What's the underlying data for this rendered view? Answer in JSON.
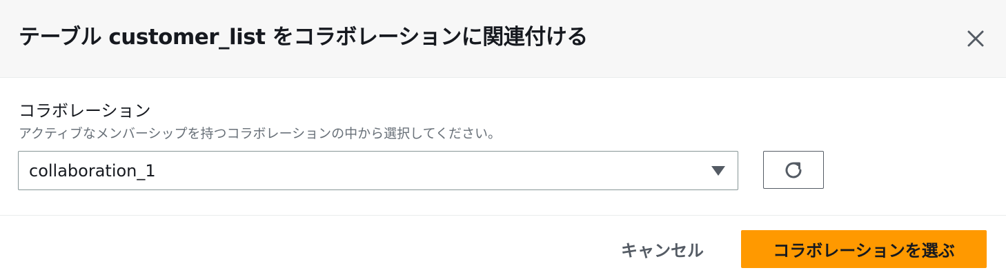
{
  "modal": {
    "title": "テーブル customer_list をコラボレーションに関連付ける",
    "close_icon": "close-icon"
  },
  "field": {
    "label": "コラボレーション",
    "description": "アクティブなメンバーシップを持つコラボレーションの中から選択してください。",
    "selected_value": "collaboration_1",
    "caret_icon": "caret-down-icon",
    "refresh_icon": "refresh-icon"
  },
  "footer": {
    "cancel_label": "キャンセル",
    "primary_label": "コラボレーションを選ぶ"
  },
  "colors": {
    "header_bg": "#f7f7f7",
    "primary": "#ff9900",
    "text": "#16191f",
    "secondary_text": "#687078",
    "border": "#879596"
  }
}
